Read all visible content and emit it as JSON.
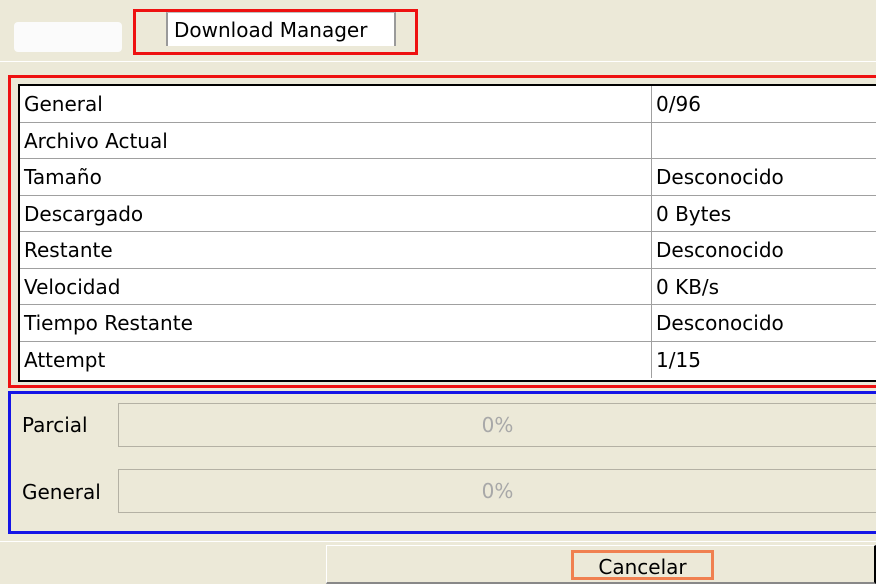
{
  "tabs": {
    "active_label": "Download Manager"
  },
  "info_rows": [
    {
      "label": "General",
      "value": "0/96"
    },
    {
      "label": "Archivo Actual",
      "value": ""
    },
    {
      "label": "Tamaño",
      "value": "Desconocido"
    },
    {
      "label": "Descargado",
      "value": "0 Bytes"
    },
    {
      "label": "Restante",
      "value": "Desconocido"
    },
    {
      "label": "Velocidad",
      "value": "0 KB/s"
    },
    {
      "label": "Tiempo Restante",
      "value": "Desconocido"
    },
    {
      "label": "Attempt",
      "value": "1/15"
    }
  ],
  "progress": {
    "parcial": {
      "label": "Parcial",
      "percent_text": "0%",
      "value": 0
    },
    "general": {
      "label": "General",
      "percent_text": "0%",
      "value": 0
    }
  },
  "buttons": {
    "cancel_label": "Cancelar"
  },
  "colors": {
    "window_bg": "#ece9d8",
    "progress_fill": "#3c9c3c",
    "percent_text": "#a8a8a8"
  }
}
